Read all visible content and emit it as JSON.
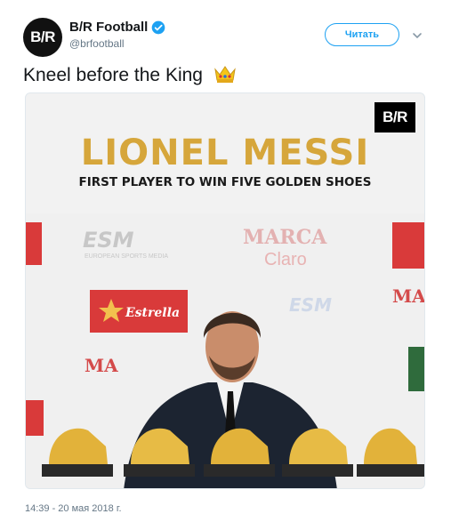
{
  "author": {
    "avatar_text": "B/R",
    "display_name": "B/R Football",
    "handle": "@brfootball",
    "verified": true
  },
  "follow_button": {
    "label": "Читать"
  },
  "tweet": {
    "text": "Kneel before the King",
    "emoji_icon": "crown-icon"
  },
  "media": {
    "logo_text": "B/R",
    "headline": "LIONEL MESSI",
    "subheadline": "FIRST PLAYER TO WIN FIVE GOLDEN SHOES",
    "backdrop_texts": [
      "ESM",
      "EUROPEAN SPORTS MEDIA",
      "MARCA",
      "Claro",
      "Estrella",
      "ESM",
      "MA",
      "MA"
    ]
  },
  "timestamp": "14:39 - 20 мая 2018 г.",
  "colors": {
    "accent": "#1da1f2",
    "headline_gold": "#d6a63b"
  }
}
